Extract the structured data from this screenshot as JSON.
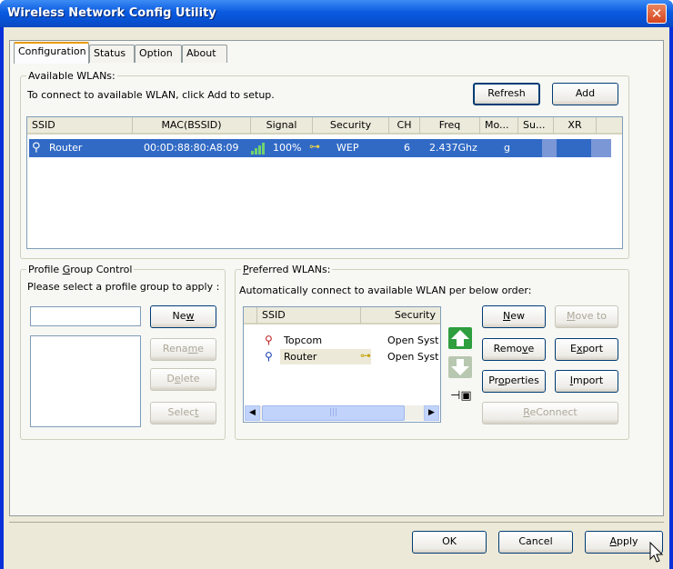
{
  "window": {
    "title": "Wireless Network Config Utility"
  },
  "tabs": [
    "Configuration",
    "Status",
    "Option",
    "About"
  ],
  "available": {
    "group_label": "Available WLANs:",
    "instruction": "To connect to available WLAN, click Add to setup.",
    "refresh_label": "Refresh",
    "add_label": "Add",
    "columns": [
      "SSID",
      "MAC(BSSID)",
      "Signal",
      "Security",
      "CH",
      "Freq",
      "Mo...",
      "Su...",
      "XR"
    ],
    "rows": [
      {
        "ssid": "Router",
        "mac": "00:0D:88:80:A8:09",
        "signal": "100%",
        "security": "WEP",
        "ch": "6",
        "freq": "2.437Ghz",
        "mode": "g"
      }
    ]
  },
  "profile": {
    "group_label": "Profile Group Control",
    "instruction": "Please select a profile group to apply :",
    "name_value": "",
    "new_label": "New",
    "rename_label": "Rename",
    "delete_label": "Delete",
    "select_label": "Select"
  },
  "preferred": {
    "group_label": "Preferred WLANs:",
    "instruction": "Automatically connect to available WLAN per below order:",
    "columns": [
      "SSID",
      "Security"
    ],
    "rows": [
      {
        "ssid": "Topcom",
        "security": "Open Syst"
      },
      {
        "ssid": "Router",
        "security": "Open Syst"
      }
    ],
    "new_label": "New",
    "moveto_label": "Move to",
    "remove_label": "Remove",
    "export_label": "Export",
    "properties_label": "Properties",
    "import_label": "Import",
    "reconnect_label": "ReConnect"
  },
  "footer": {
    "ok_label": "OK",
    "cancel_label": "Cancel",
    "apply_label": "Apply"
  },
  "colors": {
    "title_bar": "#0a5ae0",
    "selection": "#316ac5",
    "dialog_face": "#ece9d8",
    "arrow_up": "#2e9e3e",
    "arrow_down": "#b8c8b0"
  },
  "icons": {
    "close": "close-icon",
    "wireless": "wireless-icon",
    "signal": "signal-bars-icon",
    "key": "key-icon",
    "move-up": "arrow-up-icon",
    "move-down": "arrow-down-icon",
    "pin": "pin-icon",
    "cursor": "cursor-icon"
  }
}
